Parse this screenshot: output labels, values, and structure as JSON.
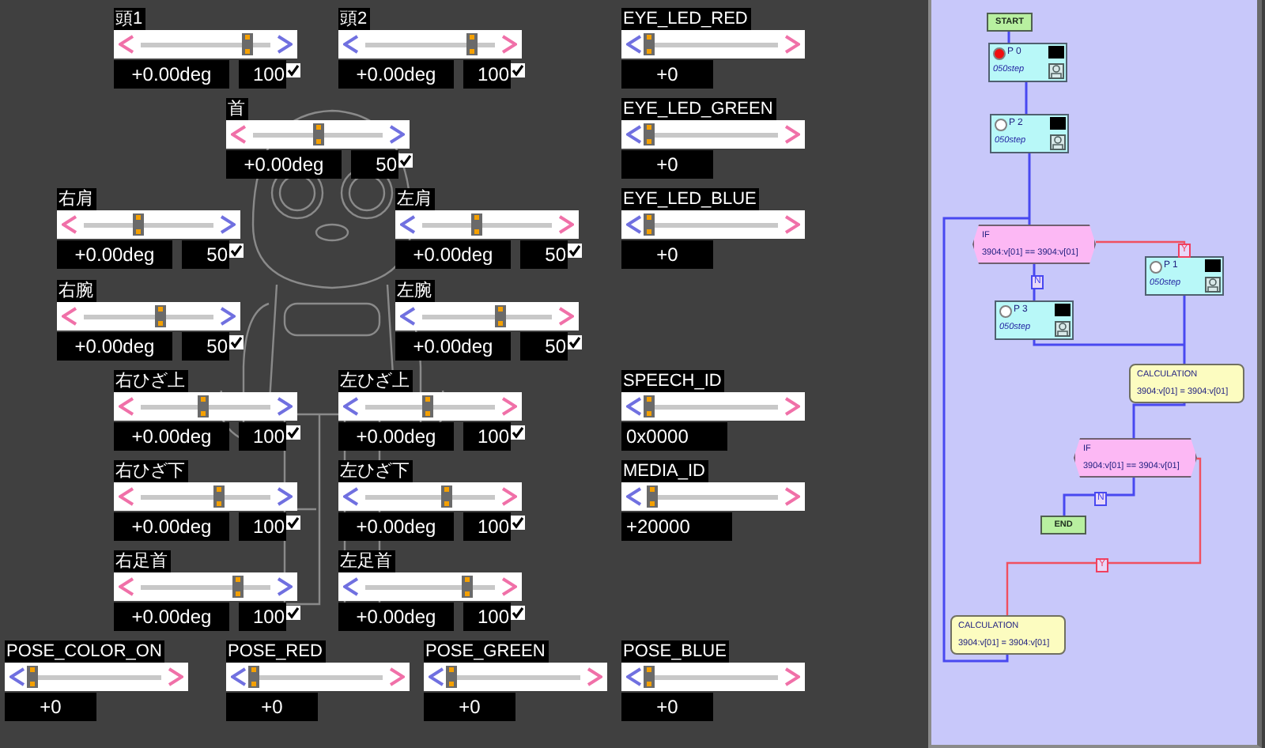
{
  "joints": [
    {
      "label": "頭1",
      "value": "+0.00deg",
      "speed": "100",
      "speed_enabled": true,
      "level": 0.82,
      "reversed": false
    },
    {
      "label": "頭2",
      "value": "+0.00deg",
      "speed": "100",
      "speed_enabled": true,
      "level": 0.82,
      "reversed": true
    },
    {
      "label": "首",
      "value": "+0.00deg",
      "speed": "50",
      "speed_enabled": true,
      "level": 0.5,
      "reversed": false
    },
    {
      "label": "右肩",
      "value": "+0.00deg",
      "speed": "50",
      "speed_enabled": true,
      "level": 0.42,
      "reversed": false
    },
    {
      "label": "左肩",
      "value": "+0.00deg",
      "speed": "50",
      "speed_enabled": true,
      "level": 0.42,
      "reversed": true
    },
    {
      "label": "右腕",
      "value": "+0.00deg",
      "speed": "50",
      "speed_enabled": true,
      "level": 0.58,
      "reversed": false
    },
    {
      "label": "左腕",
      "value": "+0.00deg",
      "speed": "50",
      "speed_enabled": true,
      "level": 0.6,
      "reversed": true
    },
    {
      "label": "右ひざ上",
      "value": "+0.00deg",
      "speed": "100",
      "speed_enabled": true,
      "level": 0.47,
      "reversed": false
    },
    {
      "label": "左ひざ上",
      "value": "+0.00deg",
      "speed": "100",
      "speed_enabled": true,
      "level": 0.47,
      "reversed": true
    },
    {
      "label": "右ひざ下",
      "value": "+0.00deg",
      "speed": "100",
      "speed_enabled": true,
      "level": 0.6,
      "reversed": false
    },
    {
      "label": "左ひざ下",
      "value": "+0.00deg",
      "speed": "100",
      "speed_enabled": true,
      "level": 0.62,
      "reversed": true
    },
    {
      "label": "右足首",
      "value": "+0.00deg",
      "speed": "100",
      "speed_enabled": true,
      "level": 0.74,
      "reversed": false
    },
    {
      "label": "左足首",
      "value": "+0.00deg",
      "speed": "100",
      "speed_enabled": true,
      "level": 0.78,
      "reversed": true
    }
  ],
  "parameters": [
    {
      "label": "EYE_LED_RED",
      "value": "+0",
      "level": 0
    },
    {
      "label": "EYE_LED_GREEN",
      "value": "+0",
      "level": 0
    },
    {
      "label": "EYE_LED_BLUE",
      "value": "+0",
      "level": 0
    },
    {
      "label": "SPEECH_ID",
      "value": "0x0000",
      "level": 0
    },
    {
      "label": "MEDIA_ID",
      "value": "+20000",
      "level": 0.03
    },
    {
      "label": "POSE_COLOR_ON",
      "value": "+0",
      "level": 0
    },
    {
      "label": "POSE_RED",
      "value": "+0",
      "level": 0
    },
    {
      "label": "POSE_GREEN",
      "value": "+0",
      "level": 0
    },
    {
      "label": "POSE_BLUE",
      "value": "+0",
      "level": 0
    }
  ],
  "flowchart": {
    "nodes": [
      {
        "kind": "terminal",
        "text": "START"
      },
      {
        "kind": "pose",
        "title": "P 0",
        "step": "050step",
        "active": true
      },
      {
        "kind": "pose",
        "title": "P 2",
        "step": "050step",
        "active": false
      },
      {
        "kind": "if",
        "title": "IF",
        "condition": "3904:v[01] == 3904:v[01]"
      },
      {
        "kind": "pose",
        "title": "P 1",
        "step": "050step",
        "active": false
      },
      {
        "kind": "pose",
        "title": "P 3",
        "step": "050step",
        "active": false
      },
      {
        "kind": "calc",
        "title": "CALCULATION",
        "expression": "3904:v[01] = 3904:v[01]"
      },
      {
        "kind": "if",
        "title": "IF",
        "condition": "3904:v[01] == 3904:v[01]"
      },
      {
        "kind": "terminal",
        "text": "END"
      },
      {
        "kind": "calc",
        "title": "CALCULATION",
        "expression": "3904:v[01] = 3904:v[01]"
      }
    ],
    "branch_labels": [
      {
        "text": "N",
        "kind": "no"
      },
      {
        "text": "Y",
        "kind": "yes"
      },
      {
        "text": "N",
        "kind": "no"
      },
      {
        "text": "Y",
        "kind": "yes"
      }
    ]
  }
}
